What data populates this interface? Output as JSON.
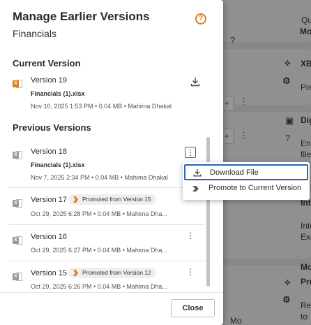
{
  "background": {
    "snippets": [
      {
        "key": "qu",
        "text": "Qu"
      },
      {
        "key": "mo1",
        "text": "Mo"
      },
      {
        "key": "xb",
        "text": "XB"
      },
      {
        "key": "pre1",
        "text": "Pre"
      },
      {
        "key": "dig",
        "text": "Dig"
      },
      {
        "key": "ena",
        "text": "Ena"
      },
      {
        "key": "file",
        "text": "file"
      },
      {
        "key": "int",
        "text": "Int"
      },
      {
        "key": "inte",
        "text": "Inte"
      },
      {
        "key": "exc",
        "text": "Exc"
      },
      {
        "key": "mo2",
        "text": "Mo"
      },
      {
        "key": "pre2",
        "text": "Pre"
      },
      {
        "key": "rea",
        "text": "Rea"
      },
      {
        "key": "to",
        "text": "to"
      },
      {
        "key": "mo3",
        "text": "Mo"
      }
    ]
  },
  "modal": {
    "title": "Manage Earlier Versions",
    "subtitle": "Financials",
    "help_icon": "question-circle-icon",
    "current_section_title": "Current Version",
    "current": {
      "name": "Version 19",
      "file": "Financials (1).xlsx",
      "meta": "Nov 10, 2025 1:53 PM • 0.04 MB • Mahima Dhakal",
      "icon": "excel-file-icon"
    },
    "previous_section_title": "Previous Versions",
    "previous": [
      {
        "name": "Version 18",
        "file": "Financials (1).xlsx",
        "meta": "Nov 7, 2025 2:34 PM • 0.04 MB • Mahima Dhakal",
        "badge": ""
      },
      {
        "name": "Version 17",
        "file": "",
        "meta": "Oct 29, 2025 6:28 PM • 0.04 MB • Mahima Dha...",
        "badge": "Promoted from Version 15"
      },
      {
        "name": "Version 16",
        "file": "",
        "meta": "Oct 29, 2025 6:27 PM • 0.04 MB • Mahima Dha...",
        "badge": ""
      },
      {
        "name": "Version 15",
        "file": "",
        "meta": "Oct 29, 2025 6:26 PM • 0.04 MB • Mahima Dha...",
        "badge": "Promoted from Version 12"
      }
    ],
    "close_label": "Close"
  },
  "context_menu": {
    "items": [
      {
        "label": "Download File",
        "icon": "download-icon"
      },
      {
        "label": "Promote to Current Version",
        "icon": "promote-chevron-icon"
      }
    ]
  },
  "colors": {
    "accent": "#e07b18",
    "focus": "#2a63b8"
  }
}
